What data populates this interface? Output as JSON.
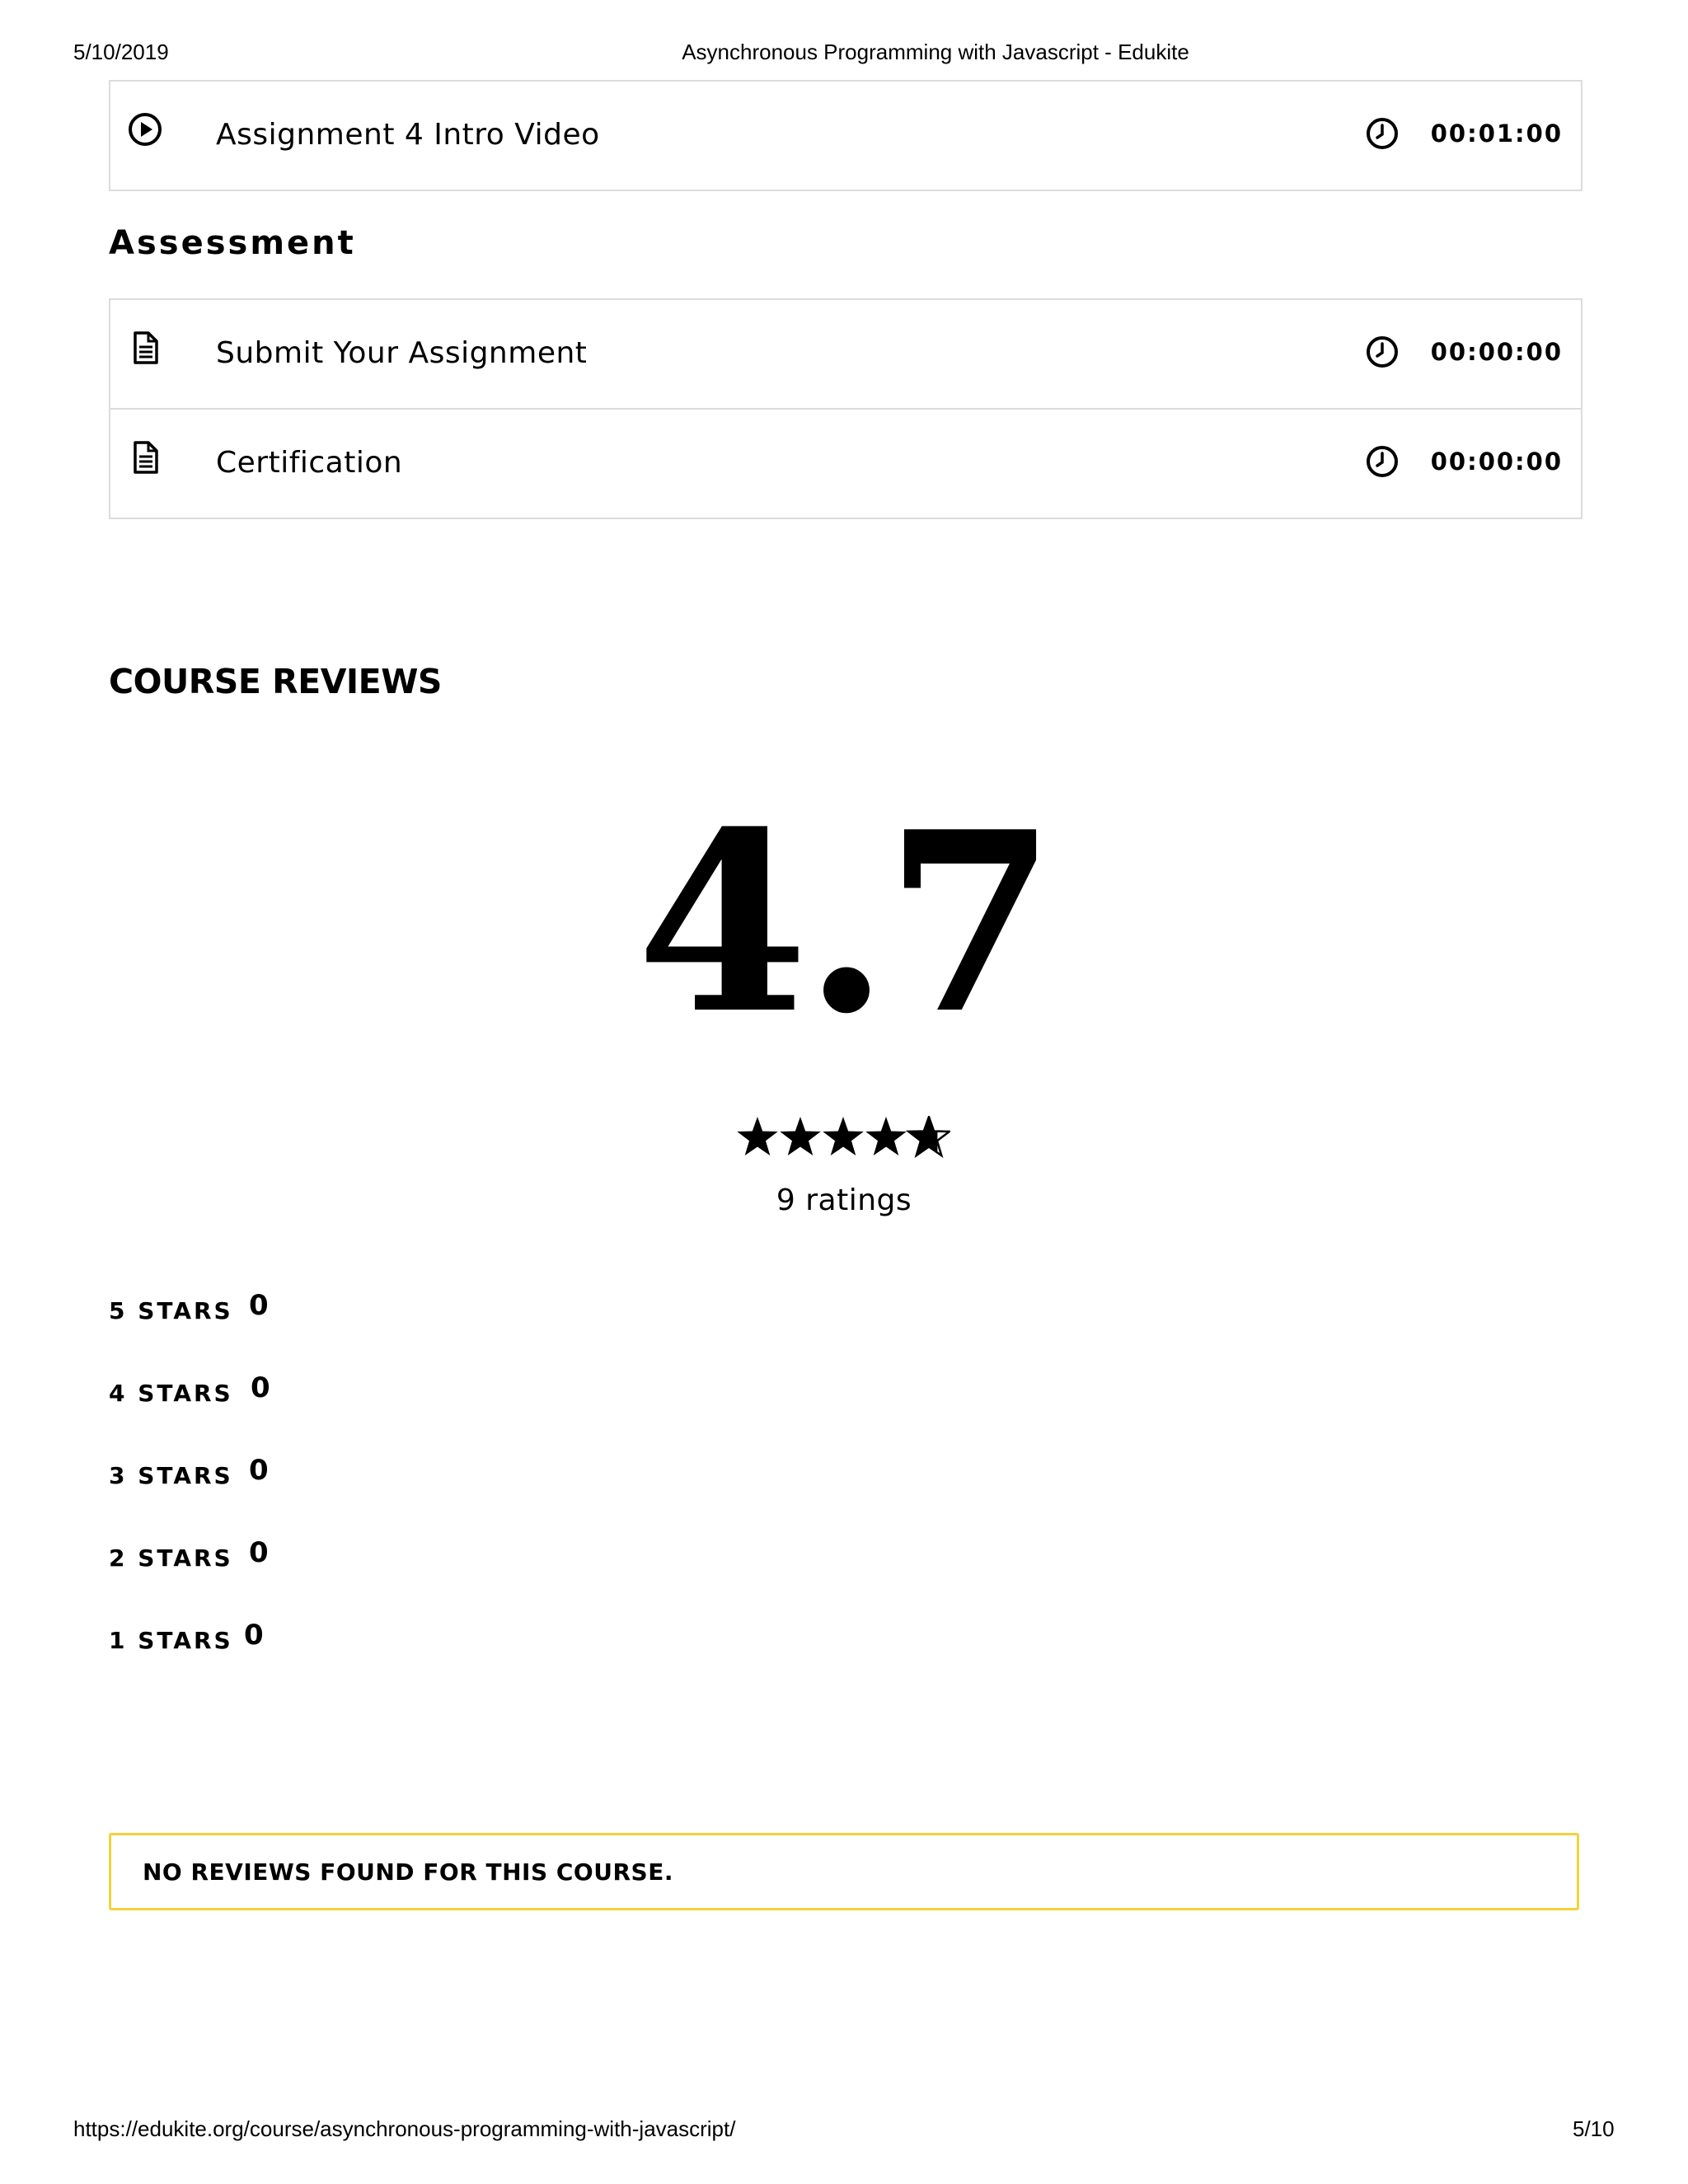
{
  "print_header": {
    "date": "5/10/2019",
    "title": "Asynchronous Programming with Javascript - Edukite"
  },
  "print_footer": {
    "url": "https://edukite.org/course/asynchronous-programming-with-javascript/",
    "page": "5/10"
  },
  "curriculum": {
    "video_lessons": [
      {
        "icon": "play-circle-icon",
        "title": "Assignment 4 Intro Video",
        "duration": "00:01:00"
      }
    ],
    "assessment": {
      "heading": "Assessment",
      "items": [
        {
          "icon": "document-icon",
          "title": "Submit Your Assignment",
          "duration": "00:00:00"
        },
        {
          "icon": "document-icon",
          "title": "Certification",
          "duration": "00:00:00"
        }
      ]
    }
  },
  "reviews": {
    "title": "COURSE REVIEWS",
    "average": "4.7",
    "stars_value": 4.7,
    "stars_max": 5,
    "ratings_count": "9 ratings",
    "breakdown": [
      {
        "label": "5 STARS",
        "count": "0"
      },
      {
        "label": "4 STARS",
        "count": "0"
      },
      {
        "label": "3 STARS",
        "count": "0"
      },
      {
        "label": "2 STARS",
        "count": "0"
      },
      {
        "label": "1 STARS",
        "count": "0"
      }
    ],
    "empty_message": "NO REVIEWS FOUND FOR THIS COURSE.",
    "notice_border_color": "#f2d23a"
  }
}
